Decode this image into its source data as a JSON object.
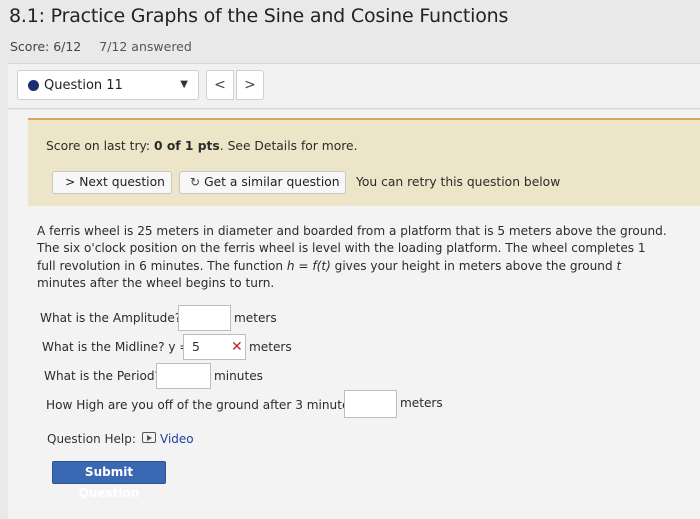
{
  "header": {
    "title": "8.1: Practice Graphs of the Sine and Cosine Functions",
    "score": "Score: 6/12",
    "answered": "7/12 answered"
  },
  "question_nav": {
    "selected": "Question 11",
    "prev_glyph": "<",
    "next_glyph": ">"
  },
  "notice": {
    "prefix": "Score on last try: ",
    "score_bold": "0 of 1 pts",
    "suffix": ". See Details for more.",
    "next_question": "> Next question",
    "similar_question": "Get a similar question",
    "retry_text": "You can retry this question below"
  },
  "problem": {
    "text_1": "A ferris wheel is 25 meters in diameter and boarded from a platform that is 5 meters above the ground. The six o'clock position on the ferris wheel is level with the loading platform. The wheel completes 1 full revolution in 6 minutes. The function ",
    "func_h": "h",
    "func_eq": " = ",
    "func_f": "f(t)",
    "text_2": " gives your height in meters above the ground ",
    "var_t": "t",
    "text_3": " minutes after the wheel begins to turn."
  },
  "questions": {
    "amplitude_label": "What is the Amplitude?",
    "amplitude_value": "",
    "amplitude_unit": "meters",
    "midline_label": "What is the Midline? y =",
    "midline_value": "5",
    "midline_unit": "meters",
    "period_label": "What is the Period?",
    "period_value": "",
    "period_unit": "minutes",
    "height_label": "How High are you off of the ground after 3 minutes?",
    "height_value": "",
    "height_unit": "meters"
  },
  "help": {
    "label": "Question Help:",
    "video": "Video"
  },
  "submit_label": "Submit Question",
  "colors": {
    "accent_blue": "#3b68b3",
    "notice_bg": "#ece5c8",
    "notice_border": "#d9a45c",
    "error_red": "#c0262d"
  }
}
